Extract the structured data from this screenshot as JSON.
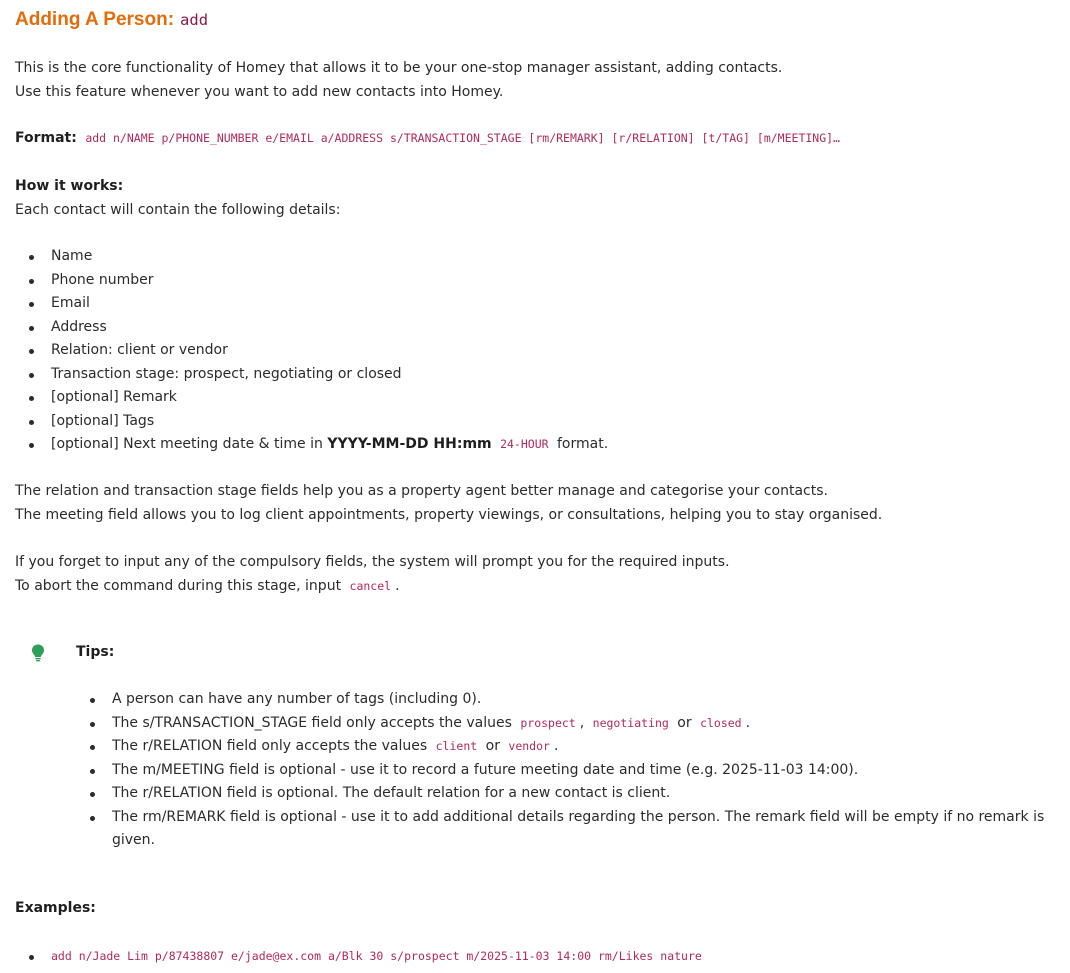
{
  "title": {
    "label": "Adding A Person:",
    "command": "add"
  },
  "intro": {
    "line1": "This is the core functionality of Homey that allows it to be your one-stop manager assistant, adding contacts.",
    "line2": "Use this feature whenever you want to add new contacts into Homey."
  },
  "format": {
    "label": "Format:",
    "value": "add n/NAME p/PHONE_NUMBER e/EMAIL a/ADDRESS s/TRANSACTION_STAGE [rm/REMARK] [r/RELATION] [t/TAG] [m/MEETING]…"
  },
  "how": {
    "heading": "How it works:",
    "desc": "Each contact will contain the following details:",
    "items": [
      "Name",
      "Phone number",
      "Email",
      "Address",
      "Relation: client or vendor",
      "Transaction stage: prospect, negotiating or closed",
      "[optional] Remark",
      "[optional] Tags"
    ],
    "last_item": {
      "prefix": "[optional] Next meeting date & time in ",
      "bold": "YYYY-MM-DD HH:mm",
      "code": "24-HOUR",
      "suffix": "format."
    }
  },
  "relation_text": {
    "line1": "The relation and transaction stage fields help you as a property agent better manage and categorise your contacts.",
    "line2": "The meeting field allows you to log client appointments, property viewings, or consultations, helping you to stay organised."
  },
  "prompt_text": {
    "line1": "If you forget to input any of the compulsory fields, the system will prompt you for the required inputs.",
    "line2_prefix": "To abort the command during this stage, input",
    "line2_code": "cancel",
    "line2_suffix": "."
  },
  "tips": {
    "icon": "lightbulb-icon",
    "icon_color": "#2e9e5b",
    "title": "Tips:",
    "tip1": "A person can have any number of tags (including 0).",
    "tip2": {
      "prefix": "The s/TRANSACTION_STAGE field only accepts the values",
      "c1": "prospect",
      "sep1": ",",
      "c2": "negotiating",
      "sep2": "or",
      "c3": "closed",
      "end": "."
    },
    "tip3": {
      "prefix": "The r/RELATION field only accepts the values",
      "c1": "client",
      "sep": "or",
      "c2": "vendor",
      "end": "."
    },
    "tip4": "The m/MEETING field is optional - use it to record a future meeting date and time (e.g. 2025-11-03 14:00).",
    "tip5": "The r/RELATION field is optional. The default relation for a new contact is client.",
    "tip6": "The rm/REMARK field is optional - use it to add additional details regarding the person. The remark field will be empty if no remark is given."
  },
  "examples": {
    "heading": "Examples:",
    "items": [
      "add n/Jade Lim p/87438807 e/jade@ex.com a/Blk 30 s/prospect m/2025-11-03 14:00 rm/Likes nature"
    ]
  },
  "colors": {
    "heading": "#e46c0a",
    "code": "#b02a5b",
    "text": "#2b2b2b"
  }
}
